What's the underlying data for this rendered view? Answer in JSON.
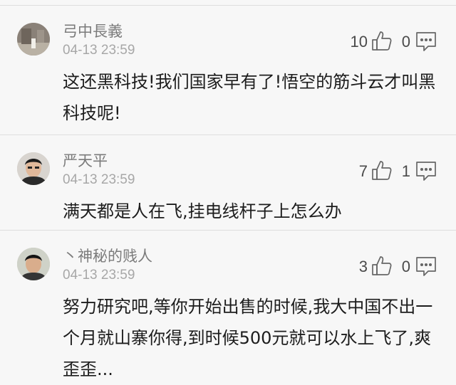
{
  "comments": [
    {
      "username": "弓中長義",
      "time": "04-13 23:59",
      "content": "这还黑科技!我们国家早有了!悟空的筋斗云才叫黑科技呢!",
      "likes": "10",
      "replies": "0",
      "avatar_icon": "photo-avatar-street"
    },
    {
      "username": "严天平",
      "time": "04-13 23:59",
      "content": "满天都是人在飞,挂电线杆子上怎么办",
      "likes": "7",
      "replies": "1",
      "avatar_icon": "photo-avatar-portrait"
    },
    {
      "username": "丶神秘的贱人",
      "time": "04-13 23:59",
      "content": "努力研究吧,等你开始出售的时候,我大中国不出一个月就山寨你得,到时候500元就可以水上飞了,爽歪歪...",
      "likes": "3",
      "replies": "0",
      "avatar_icon": "photo-avatar-portrait"
    }
  ],
  "icons": {
    "like": "thumbs-up-icon",
    "reply": "comment-icon"
  }
}
